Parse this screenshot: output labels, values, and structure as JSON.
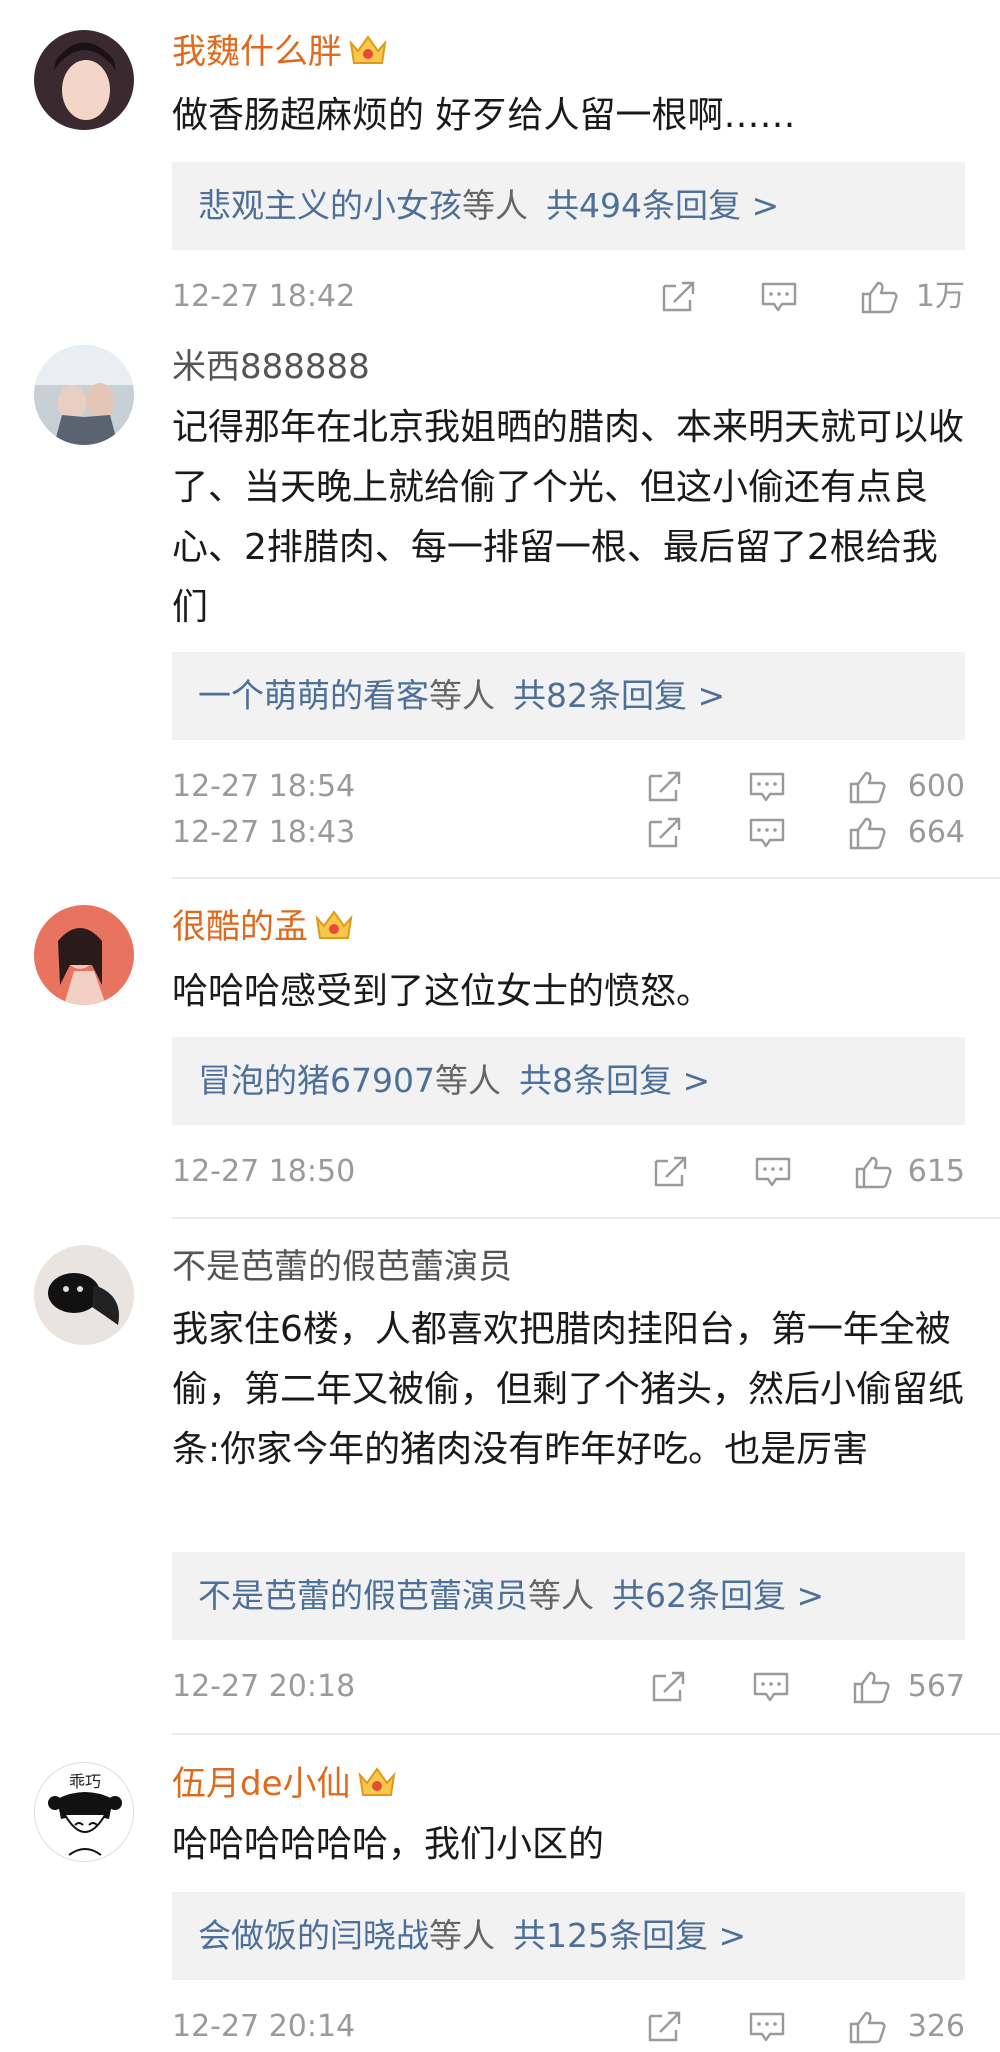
{
  "comments": [
    {
      "user": "我魏什么胖",
      "vip": true,
      "content": "做香肠超麻烦的 好歹给人留一根啊……",
      "reply_users": "悲观主义的小女孩",
      "reply_mid": "等人",
      "reply_count": "共494条回复 >",
      "time": "12-27 18:42",
      "likes": "1万"
    },
    {
      "user": "米西888888",
      "vip": false,
      "content": "记得那年在北京我姐晒的腊肉、本来明天就可以收了、当天晚上就给偷了个光、但这小偷还有点良心、2排腊肉、每一排留一根、最后留了2根给我们",
      "reply_users": "一个萌萌的看客",
      "reply_mid": "等人",
      "reply_count": "共82条回复 >",
      "time": "12-27 18:54",
      "likes": "600",
      "time2": "12-27 18:43",
      "likes2": "664"
    },
    {
      "user": "很酷的孟",
      "vip": true,
      "content": "哈哈哈感受到了这位女士的愤怒。",
      "reply_users": "冒泡的猪67907",
      "reply_mid": "等人",
      "reply_count": "共8条回复 >",
      "time": "12-27 18:50",
      "likes": "615"
    },
    {
      "user": "不是芭蕾的假芭蕾演员",
      "vip": false,
      "content": "我家住6楼，人都喜欢把腊肉挂阳台，第一年全被偷，第二年又被偷，但剩了个猪头，然后小偷留纸条:你家今年的猪肉没有昨年好吃。也是厉害",
      "reply_users": "不是芭蕾的假芭蕾演员",
      "reply_mid": "等人",
      "reply_count": "共62条回复 >",
      "time": "12-27 20:18",
      "likes": "567"
    },
    {
      "user": "伍月de小仙",
      "vip": true,
      "avatar_text": "乖巧",
      "content": "哈哈哈哈哈哈，我们小区的",
      "reply_users": "会做饭的闫晓战",
      "reply_mid": "等人",
      "reply_count": "共125条回复 >",
      "time": "12-27 20:14",
      "likes": "326"
    }
  ],
  "colors": {
    "vip_name": "#e06a1c",
    "link": "#4d6f98",
    "meta": "#9a9a9a",
    "reply_bg": "#f2f2f2"
  },
  "icons": [
    "crown-icon",
    "share-icon",
    "comment-icon",
    "like-icon"
  ]
}
